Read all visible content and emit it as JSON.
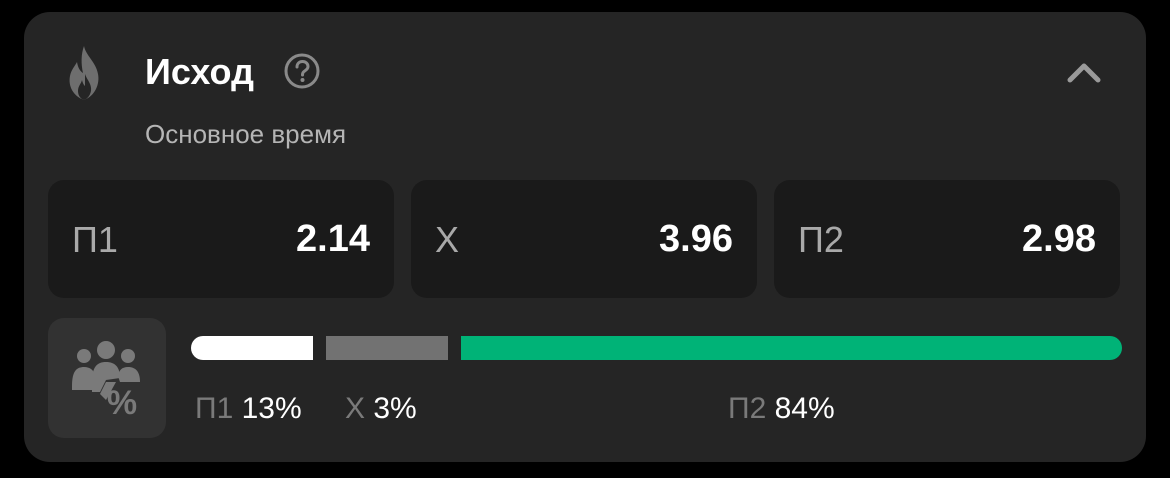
{
  "market": {
    "title": "Исход",
    "subtitle": "Основное время",
    "icons": {
      "title_icon": "fire-icon",
      "help": "question-circle-icon",
      "collapse": "chevron-up-icon",
      "stats": "people-percent-icon"
    }
  },
  "odds": [
    {
      "label": "П1",
      "value": "2.14"
    },
    {
      "label": "Х",
      "value": "3.96"
    },
    {
      "label": "П2",
      "value": "2.98"
    }
  ],
  "distribution": [
    {
      "label": "П1",
      "percent": "13%",
      "fraction": 0.13,
      "color": "#ffffff"
    },
    {
      "label": "Х",
      "percent": "3%",
      "fraction": 0.03,
      "color": "#727272"
    },
    {
      "label": "П2",
      "percent": "84%",
      "fraction": 0.84,
      "color": "#00b377"
    }
  ]
}
